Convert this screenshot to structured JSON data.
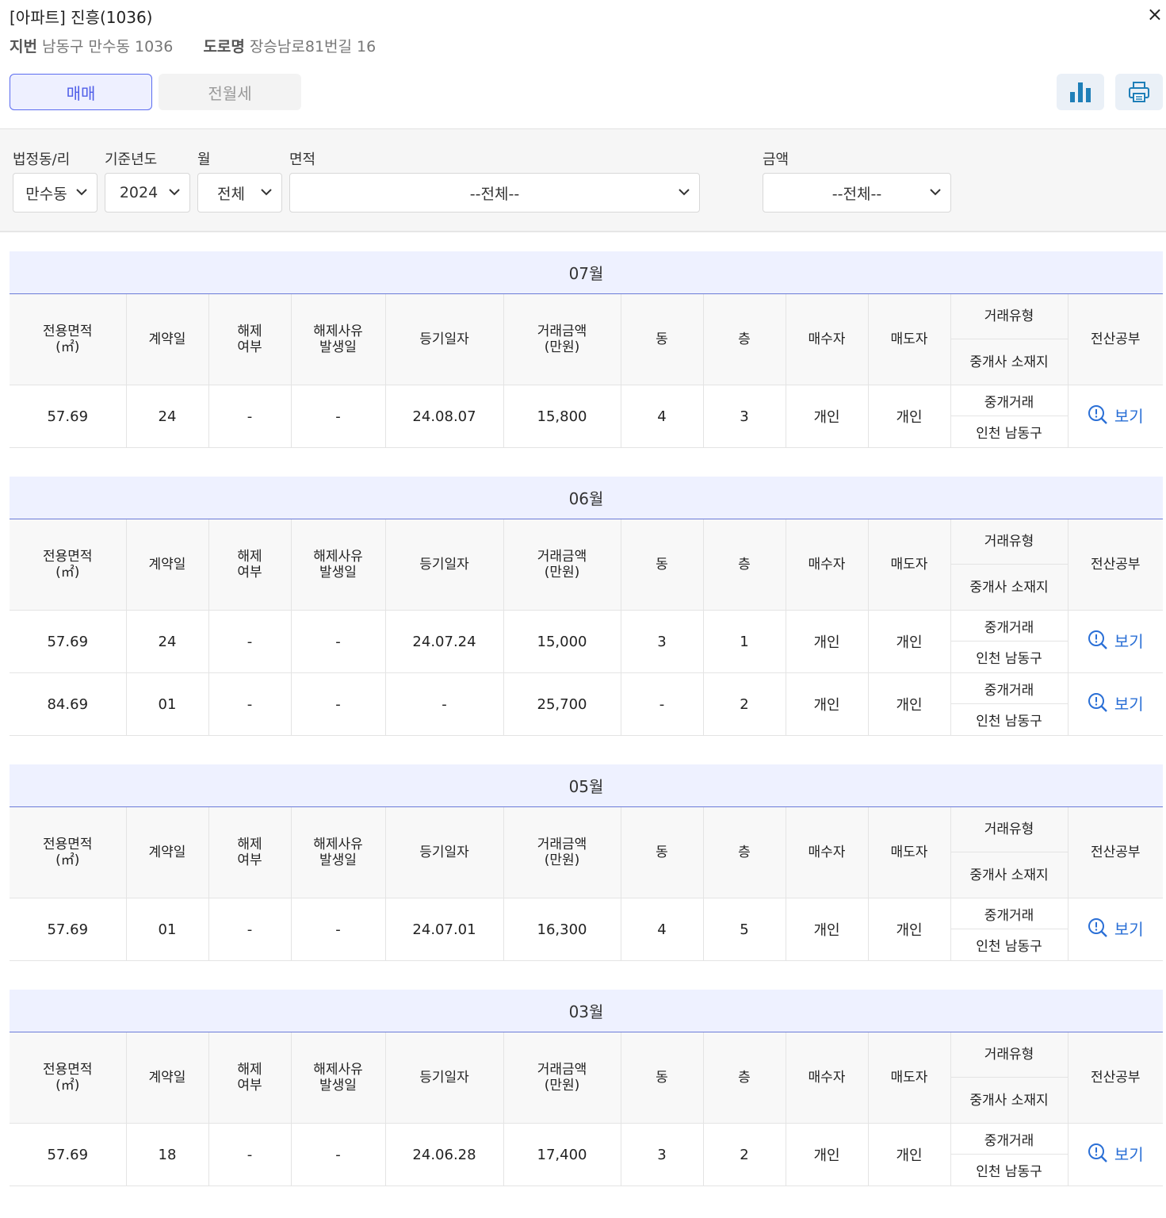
{
  "header": {
    "title": "[아파트] 진흥(1036)",
    "close_label": "×",
    "jibun_label": "지번",
    "jibun_value": "남동구 만수동 1036",
    "road_label": "도로명",
    "road_value": "장승남로81번길 16"
  },
  "tabs": [
    {
      "label": "매매",
      "active": true
    },
    {
      "label": "전월세",
      "active": false
    }
  ],
  "toolbar": {
    "chart_icon": "bar-chart-icon",
    "print_icon": "printer-icon"
  },
  "filters": {
    "dong": {
      "label": "법정동/리",
      "value": "만수동"
    },
    "year": {
      "label": "기준년도",
      "value": "2024"
    },
    "month": {
      "label": "월",
      "value": "전체"
    },
    "area": {
      "label": "면적",
      "value": "--전체--"
    },
    "price": {
      "label": "금액",
      "value": "--전체--"
    }
  },
  "columns": {
    "area": [
      "전용면적",
      "(㎡)"
    ],
    "contract_day": "계약일",
    "cancel": [
      "해제",
      "여부"
    ],
    "cancel_date": [
      "해제사유",
      "발생일"
    ],
    "reg_date": "등기일자",
    "price": [
      "거래금액",
      "(만원)"
    ],
    "building": "동",
    "floor": "층",
    "buyer": "매수자",
    "seller": "매도자",
    "deal_type": "거래유형",
    "agent_loc": "중개사 소재지",
    "doc": "전산공부"
  },
  "view_label": "보기",
  "months": [
    {
      "title": "07월",
      "rows": [
        {
          "area": "57.69",
          "day": "24",
          "cancel": "-",
          "cancel_date": "-",
          "reg": "24.08.07",
          "price": "15,800",
          "dong": "4",
          "floor": "3",
          "buyer": "개인",
          "seller": "개인",
          "type": "중개거래",
          "loc": "인천 남동구"
        }
      ]
    },
    {
      "title": "06월",
      "rows": [
        {
          "area": "57.69",
          "day": "24",
          "cancel": "-",
          "cancel_date": "-",
          "reg": "24.07.24",
          "price": "15,000",
          "dong": "3",
          "floor": "1",
          "buyer": "개인",
          "seller": "개인",
          "type": "중개거래",
          "loc": "인천 남동구"
        },
        {
          "area": "84.69",
          "day": "01",
          "cancel": "-",
          "cancel_date": "-",
          "reg": "-",
          "price": "25,700",
          "dong": "-",
          "floor": "2",
          "buyer": "개인",
          "seller": "개인",
          "type": "중개거래",
          "loc": "인천 남동구"
        }
      ]
    },
    {
      "title": "05월",
      "rows": [
        {
          "area": "57.69",
          "day": "01",
          "cancel": "-",
          "cancel_date": "-",
          "reg": "24.07.01",
          "price": "16,300",
          "dong": "4",
          "floor": "5",
          "buyer": "개인",
          "seller": "개인",
          "type": "중개거래",
          "loc": "인천 남동구"
        }
      ]
    },
    {
      "title": "03월",
      "rows": [
        {
          "area": "57.69",
          "day": "18",
          "cancel": "-",
          "cancel_date": "-",
          "reg": "24.06.28",
          "price": "17,400",
          "dong": "3",
          "floor": "2",
          "buyer": "개인",
          "seller": "개인",
          "type": "중개거래",
          "loc": "인천 남동구"
        }
      ]
    }
  ]
}
